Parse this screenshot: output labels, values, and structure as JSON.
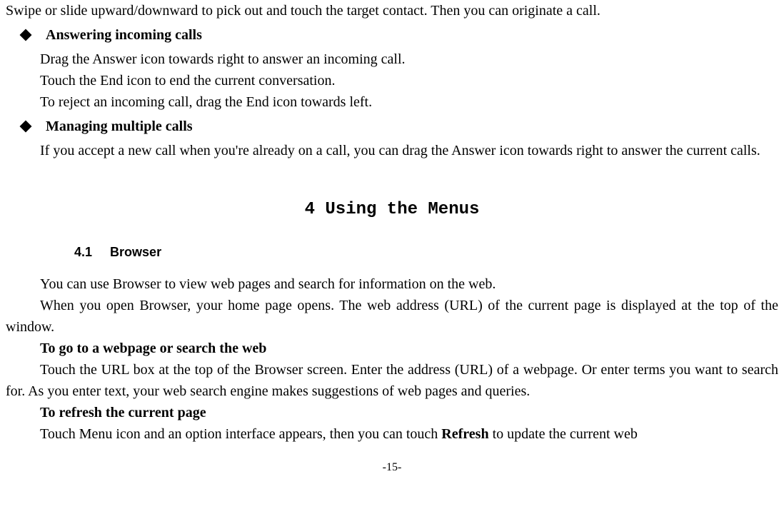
{
  "intro_line": "Swipe or slide upward/downward to pick out and touch the target contact. Then you can originate a call.",
  "sections": {
    "answering": {
      "title": "Answering incoming calls",
      "lines": {
        "l1": "Drag the Answer icon towards right to answer an incoming call.",
        "l2": "Touch the End icon to end the current conversation.",
        "l3": "To reject an incoming call, drag the End icon towards left."
      }
    },
    "multiple": {
      "title": "Managing multiple calls",
      "body": "If you accept a new call when you're already on a call, you can drag the Answer icon towards right to answer the current calls."
    }
  },
  "heading": "4 Using the Menus",
  "subsection": {
    "number": "4.1",
    "title": "Browser"
  },
  "browser": {
    "p1": "You can use Browser to view web pages and search for information on the web.",
    "p2": "When you open Browser, your home page opens. The web address (URL) of the current page is displayed at the top of the window.",
    "goto_title": "To go to a webpage or search the web",
    "goto_body": "Touch the URL box at the top of the Browser screen. Enter the address (URL) of a webpage. Or enter terms you want to search for. As you enter text, your web search engine makes suggestions of web pages and queries.",
    "refresh_title": "To refresh the current page",
    "refresh_body_prefix": "Touch Menu icon and an option interface appears, then you can touch ",
    "refresh_word": "Refresh",
    "refresh_body_suffix": " to update the current web"
  },
  "page_number": "-15-"
}
